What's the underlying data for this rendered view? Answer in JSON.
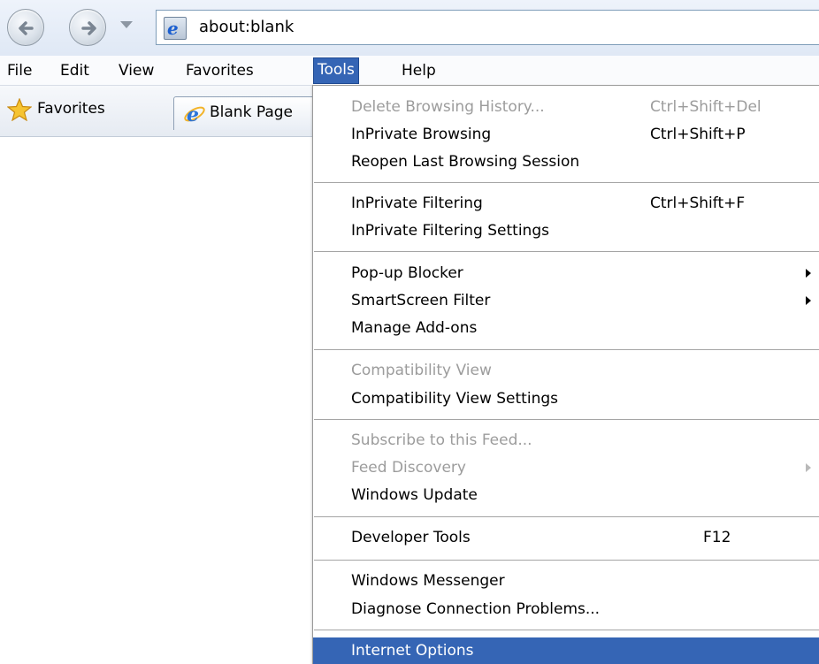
{
  "address_bar": {
    "url": "about:blank"
  },
  "menubar": {
    "items": [
      "File",
      "Edit",
      "View",
      "Favorites",
      "Tools",
      "Help"
    ],
    "active": "Tools"
  },
  "favorites_bar": {
    "favorites_label": "Favorites",
    "tab_title": "Blank Page"
  },
  "tools_menu": {
    "items": [
      {
        "label": "Delete Browsing History...",
        "shortcut": "Ctrl+Shift+Del",
        "disabled": true
      },
      {
        "label": "InPrivate Browsing",
        "shortcut": "Ctrl+Shift+P"
      },
      {
        "label": "Reopen Last Browsing Session",
        "shortcut": ""
      },
      {
        "label": "InPrivate Filtering",
        "shortcut": "Ctrl+Shift+F"
      },
      {
        "label": "InPrivate Filtering Settings",
        "shortcut": ""
      },
      {
        "label": "Pop-up Blocker",
        "submenu": true
      },
      {
        "label": "SmartScreen Filter",
        "submenu": true
      },
      {
        "label": "Manage Add-ons"
      },
      {
        "label": "Compatibility View",
        "disabled": true
      },
      {
        "label": "Compatibility View Settings"
      },
      {
        "label": "Subscribe to this Feed...",
        "disabled": true
      },
      {
        "label": "Feed Discovery",
        "disabled": true,
        "submenu": true
      },
      {
        "label": "Windows Update"
      },
      {
        "label": "Developer Tools",
        "shortcut": "F12"
      },
      {
        "label": "Windows Messenger"
      },
      {
        "label": "Diagnose Connection Problems..."
      },
      {
        "label": "Internet Options",
        "selected": true
      }
    ]
  },
  "colors": {
    "menu_highlight": "#3565b5",
    "disabled_text": "#9c9c9c"
  },
  "icons": [
    "back-arrow-icon",
    "forward-arrow-icon",
    "ie-logo-icon",
    "favorites-star-icon",
    "submenu-arrow-icon"
  ]
}
